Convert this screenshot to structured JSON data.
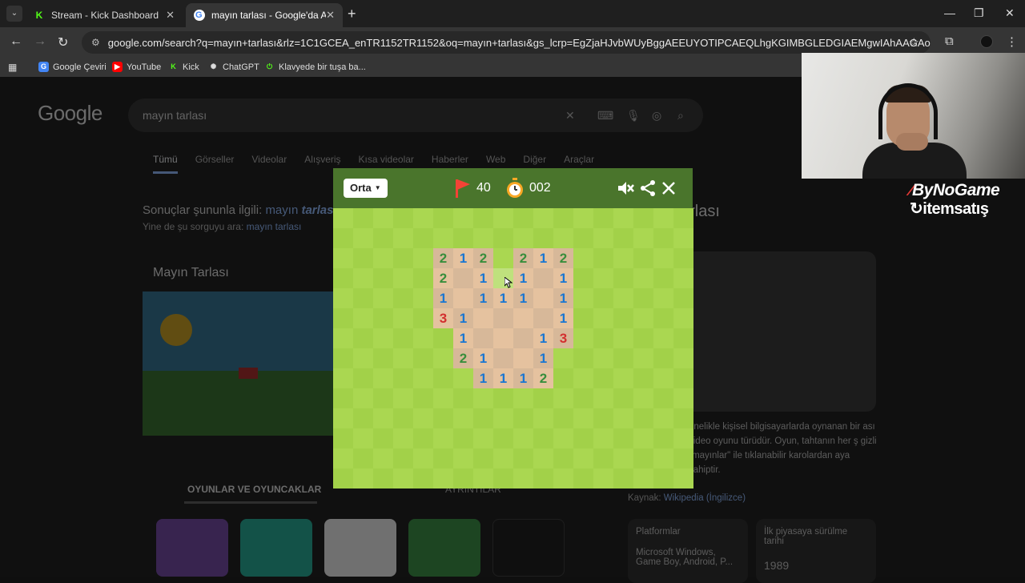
{
  "browser": {
    "tabs": [
      {
        "title": "Stream - Kick Dashboard",
        "active": false
      },
      {
        "title": "mayın tarlası - Google'da Ara",
        "active": true
      }
    ],
    "url": "google.com/search?q=mayın+tarlası&rlz=1C1GCEA_enTR1152TR1152&oq=mayın+tarlası&gs_lcrp=EgZjaHJvbWUyBggAEEUYOTIPCAEQLhgKGIMBGLEDGIAEMgwIAhAAGAoYsQMYgAQyCQg...",
    "bookmarks": [
      "Google Çeviri",
      "YouTube",
      "Kick",
      "ChatGPT",
      "Klavyede bir tuşa ba..."
    ]
  },
  "google": {
    "logo": "Google",
    "query": "mayın tarlası",
    "tabs": [
      "Tümü",
      "Görseller",
      "Videolar",
      "Alışveriş",
      "Kısa videolar",
      "Haberler",
      "Web",
      "Diğer",
      "Araçlar"
    ],
    "note_prefix": "Sonuçlar şununla ilgili:",
    "note_word1": "mayın",
    "note_word2": "tarlası",
    "note2_prefix": "Yine de şu sorguyu ara:",
    "note2_link": "mayın tarlası",
    "card_title": "Mayın Tarlası",
    "games_tab": "OYUNLAR VE OYUNCAKLAR",
    "games_tab2": "AYRINTILAR",
    "kp_title": "arlası",
    "kp_desc": "enelikle kişisel bilgisayarlarda oynanan bir ası video oyunu türüdür. Oyun, tahtanın her ş gizli \"mayınlar\" ile tıklanabilir karolardan aya sahiptir.",
    "kp_source_label": "Kaynak:",
    "kp_source_link": "Wikipedia (İngilizce)",
    "kp_platform_label": "Platformlar",
    "kp_platform_value": "Microsoft Windows, Game Boy, Android, P...",
    "kp_release_label": "İlk piyasaya sürülme tarihi",
    "kp_release_value": "1989"
  },
  "game": {
    "difficulty": "Orta",
    "flags_remaining": "40",
    "timer": "002",
    "colors": {
      "header": "#4a752c",
      "grass_light": "#aad751",
      "grass_dark": "#a2d149",
      "dirt_light": "#e5c29f",
      "dirt_dark": "#d7b899",
      "hover": "#bfe17d",
      "n1": "#1976d2",
      "n2": "#388e3c",
      "n3": "#d32f2f"
    },
    "grid_cols": 18,
    "grid_rows": 14,
    "revealed": [
      [
        5,
        2,
        "2"
      ],
      [
        6,
        2,
        "1"
      ],
      [
        7,
        2,
        "2"
      ],
      [
        9,
        2,
        "2"
      ],
      [
        10,
        2,
        "1"
      ],
      [
        11,
        2,
        "2"
      ],
      [
        5,
        3,
        "2"
      ],
      [
        6,
        3,
        ""
      ],
      [
        7,
        3,
        "1"
      ],
      [
        9,
        3,
        "1"
      ],
      [
        10,
        3,
        ""
      ],
      [
        11,
        3,
        "1"
      ],
      [
        5,
        4,
        "1"
      ],
      [
        6,
        4,
        ""
      ],
      [
        7,
        4,
        "1"
      ],
      [
        8,
        4,
        "1"
      ],
      [
        9,
        4,
        "1"
      ],
      [
        10,
        4,
        ""
      ],
      [
        11,
        4,
        "1"
      ],
      [
        5,
        5,
        "3"
      ],
      [
        6,
        5,
        "1"
      ],
      [
        7,
        5,
        ""
      ],
      [
        8,
        5,
        ""
      ],
      [
        9,
        5,
        ""
      ],
      [
        10,
        5,
        ""
      ],
      [
        11,
        5,
        "1"
      ],
      [
        6,
        6,
        "1"
      ],
      [
        7,
        6,
        ""
      ],
      [
        8,
        6,
        ""
      ],
      [
        9,
        6,
        ""
      ],
      [
        10,
        6,
        "1"
      ],
      [
        11,
        6,
        "3"
      ],
      [
        6,
        7,
        "2"
      ],
      [
        7,
        7,
        "1"
      ],
      [
        8,
        7,
        ""
      ],
      [
        9,
        7,
        ""
      ],
      [
        10,
        7,
        "1"
      ],
      [
        7,
        8,
        "1"
      ],
      [
        8,
        8,
        "1"
      ],
      [
        9,
        8,
        "1"
      ],
      [
        10,
        8,
        "2"
      ]
    ],
    "hover_cell": [
      8,
      3
    ]
  },
  "sponsor": {
    "line1": "ByNoGame",
    "line2": "itemsatış"
  }
}
